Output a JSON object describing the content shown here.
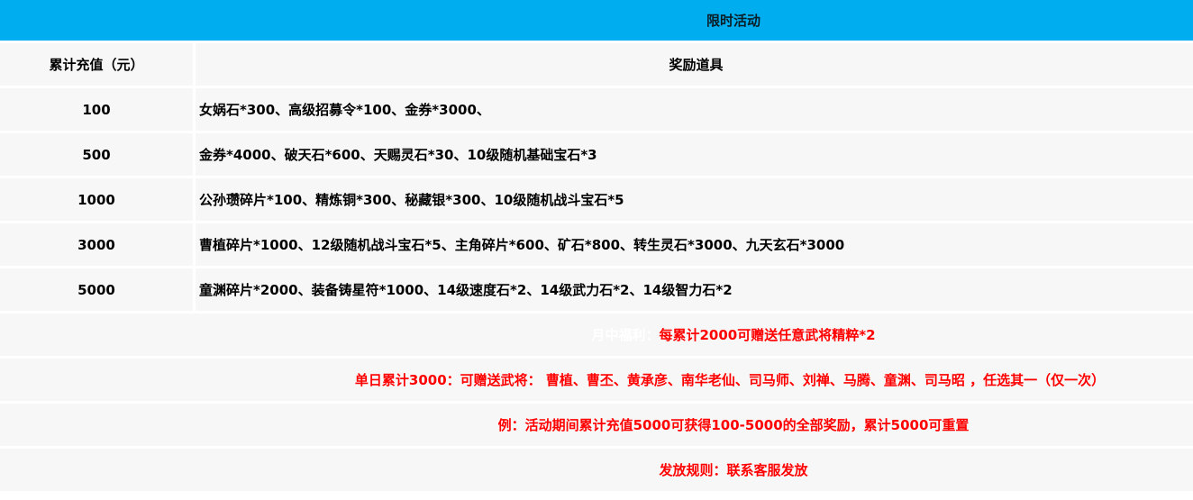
{
  "header": {
    "title": "限时活动"
  },
  "table": {
    "columns": [
      "累计充值（元）",
      "奖励道具"
    ],
    "rows": [
      {
        "amount": "100",
        "reward": "女娲石*300、高级招募令*100、金券*3000、"
      },
      {
        "amount": "500",
        "reward": "金券*4000、破天石*600、天赐灵石*30、10级随机基础宝石*3"
      },
      {
        "amount": "1000",
        "reward": "公孙瓒碎片*100、精炼铜*300、秘藏银*300、10级随机战斗宝石*5"
      },
      {
        "amount": "3000",
        "reward": "曹植碎片*1000、12级随机战斗宝石*5、主角碎片*600、矿石*800、转生灵石*3000、九天玄石*3000"
      },
      {
        "amount": "5000",
        "reward": "童渊碎片*2000、装备铸星符*1000、14级速度石*2、14级武力石*2、14级智力石*2"
      }
    ]
  },
  "notes": {
    "monthly_label": "月中福利：",
    "monthly_text": "每累计2000可赠送任意武将精粹*2",
    "daily": "单日累计3000：可赠送武将：  曹植、曹丕、黄承彦、南华老仙、司马师、刘禅、马腾、童渊、司马昭 ，任选其一（仅一次）",
    "example": "例：活动期间累计充值5000可获得100-5000的全部奖励，累计5000可重置",
    "rule": "发放规则：联系客服发放"
  },
  "colors": {
    "header_bg": "#00aeef",
    "cell_bg": "#f7f7f7",
    "note_red": "#ff0000"
  }
}
